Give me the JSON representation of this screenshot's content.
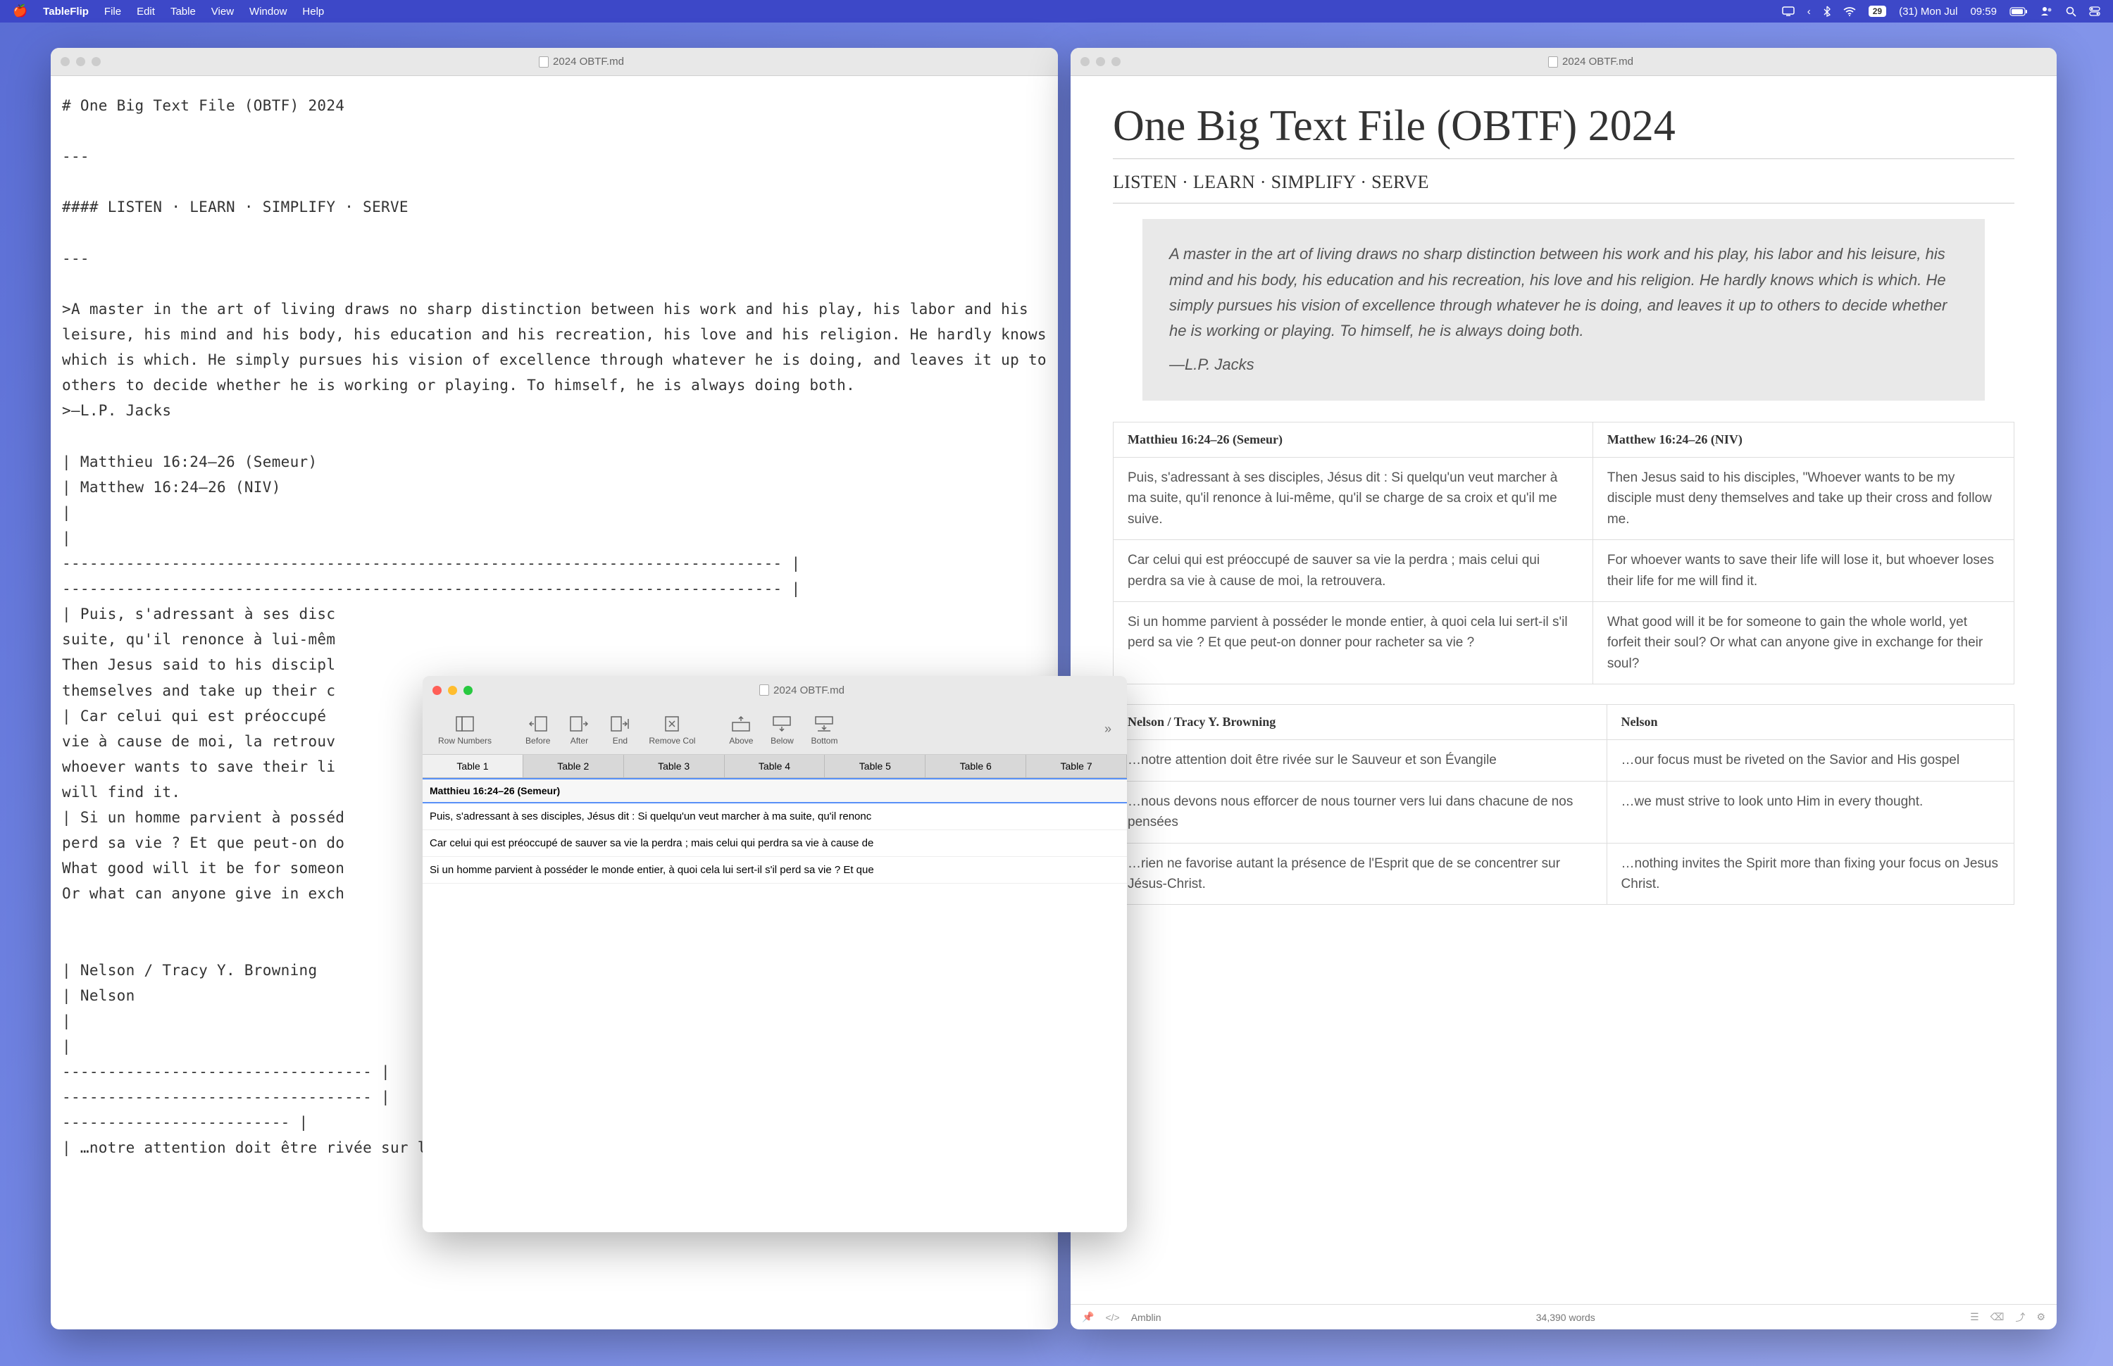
{
  "menubar": {
    "app": "TableFlip",
    "items": [
      "File",
      "Edit",
      "Table",
      "View",
      "Window",
      "Help"
    ],
    "calendar_badge": "29",
    "date_text": "(31) Mon Jul",
    "time": "09:59"
  },
  "left_window": {
    "title": "2024 OBTF.md",
    "content": "# One Big Text File (OBTF) 2024\n\n---\n\n#### LISTEN · LEARN · SIMPLIFY · SERVE\n\n---\n\n>A master in the art of living draws no sharp distinction between his work and his play, his labor and his leisure, his mind and his body, his education and his recreation, his love and his religion. He hardly knows which is which. He simply pursues his vision of excellence through whatever he is doing, and leaves it up to others to decide whether he is working or playing. To himself, he is always doing both.\n>—L.P. Jacks\n\n| Matthieu 16:24–26 (Semeur)\n| Matthew 16:24–26 (NIV)\n|\n|\n------------------------------------------------------------------------------- |\n------------------------------------------------------------------------------- |\n| Puis, s'adressant à ses disc\nsuite, qu'il renonce à lui-mêm\nThen Jesus said to his discipl\nthemselves and take up their c\n| Car celui qui est préoccupé\nvie à cause de moi, la retrouv\nwhoever wants to save their li\nwill find it.\n| Si un homme parvient à posséd\nperd sa vie ? Et que peut-on do\nWhat good will it be for someon\nOr what can anyone give in exch\n\n\n| Nelson / Tracy Y. Browning\n| Nelson\n|\n|\n---------------------------------- |\n---------------------------------- |\n------------------------- |\n| …notre attention doit être rivée sur le Sauveur et son Évangile"
  },
  "right_window": {
    "title": "2024 OBTF.md",
    "h1": "One Big Text File (OBTF) 2024",
    "h4": "LISTEN · LEARN · SIMPLIFY · SERVE",
    "quote": "A master in the art of living draws no sharp distinction between his work and his play, his labor and his leisure, his mind and his body, his education and his recreation, his love and his religion. He hardly knows which is which. He simply pursues his vision of excellence through whatever he is doing, and leaves it up to others to decide whether he is working or playing. To himself, he is always doing both.",
    "quote_author": "—L.P. Jacks",
    "table1": {
      "headers": [
        "Matthieu 16:24–26 (Semeur)",
        "Matthew 16:24–26 (NIV)"
      ],
      "rows": [
        [
          "Puis, s'adressant à ses disciples, Jésus dit : Si quelqu'un veut marcher à ma suite, qu'il renonce à lui-même, qu'il se charge de sa croix et qu'il me suive.",
          "Then Jesus said to his disciples, \"Whoever wants to be my disciple must deny themselves and take up their cross and follow me."
        ],
        [
          "Car celui qui est préoccupé de sauver sa vie la perdra ; mais celui qui perdra sa vie à cause de moi, la retrouvera.",
          "For whoever wants to save their life will lose it, but whoever loses their life for me will find it."
        ],
        [
          "Si un homme parvient à posséder le monde entier, à quoi cela lui sert-il s'il perd sa vie ? Et que peut-on donner pour racheter sa vie ?",
          "What good will it be for someone to gain the whole world, yet forfeit their soul? Or what can anyone give in exchange for their soul?"
        ]
      ]
    },
    "table2": {
      "headers": [
        "Nelson / Tracy Y. Browning",
        "Nelson"
      ],
      "rows": [
        [
          "…notre attention doit être rivée sur le Sauveur et son Évangile",
          "…our focus must be riveted on the Savior and His gospel"
        ],
        [
          "…nous devons nous efforcer de nous tourner vers lui dans chacune de nos pensées",
          "…we must strive to look unto Him in every thought."
        ],
        [
          "…rien ne favorise autant la présence de l'Esprit que de se concentrer sur Jésus-Christ.",
          "…nothing invites the Spirit more than fixing your focus on Jesus Christ."
        ]
      ]
    },
    "statusbar": {
      "theme": "Amblin",
      "words": "34,390 words"
    }
  },
  "float_window": {
    "title": "2024 OBTF.md",
    "tools": [
      {
        "icon": "row-num",
        "label": "Row Numbers"
      },
      {
        "icon": "before",
        "label": "Before"
      },
      {
        "icon": "after",
        "label": "After"
      },
      {
        "icon": "end",
        "label": "End"
      },
      {
        "icon": "remove",
        "label": "Remove Col"
      },
      {
        "icon": "above",
        "label": "Above"
      },
      {
        "icon": "below",
        "label": "Below"
      },
      {
        "icon": "bottom",
        "label": "Bottom"
      }
    ],
    "tabs": [
      "Table 1",
      "Table 2",
      "Table 3",
      "Table 4",
      "Table 5",
      "Table 6",
      "Table 7"
    ],
    "active_tab": 0,
    "header": "Matthieu 16:24–26 (Semeur)",
    "rows": [
      "Puis, s'adressant à ses disciples, Jésus dit : Si quelqu'un veut marcher à ma suite, qu'il renonc",
      "Car celui qui est préoccupé de sauver sa vie la perdra ; mais celui qui perdra sa vie à cause de",
      "Si un homme parvient à posséder le monde entier, à quoi cela lui sert-il s'il perd sa vie ? Et que"
    ]
  }
}
